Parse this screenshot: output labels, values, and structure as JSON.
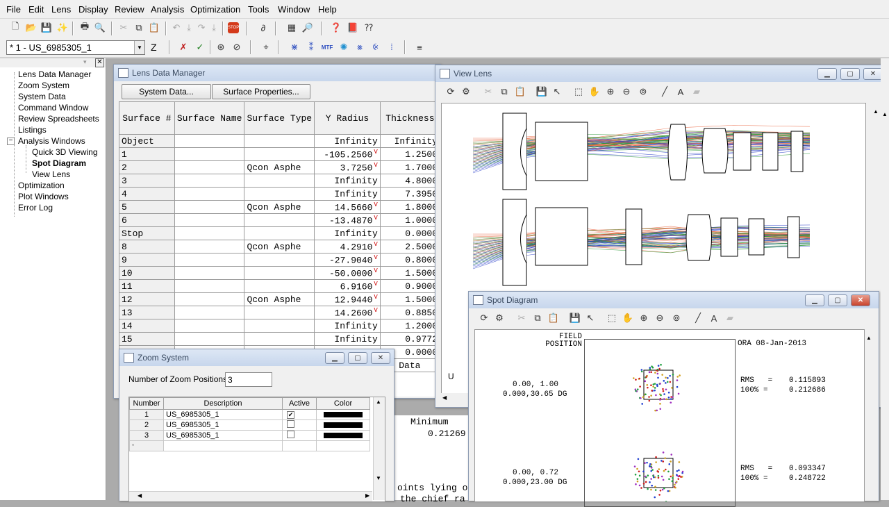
{
  "menu": [
    "File",
    "Edit",
    "Lens",
    "Display",
    "Review",
    "Analysis",
    "Optimization",
    "Tools",
    "Window",
    "Help"
  ],
  "toolbar": {
    "lens_select": "* 1 - US_6985305_1",
    "z_label": "Z"
  },
  "tree": {
    "items": [
      "Lens Data Manager",
      "Zoom System",
      "System Data",
      "Command Window",
      "Review Spreadsheets",
      "Listings",
      "Analysis Windows",
      "Quick 3D Viewing",
      "Spot Diagram",
      "View Lens",
      "Optimization",
      "Plot Windows",
      "Error Log"
    ],
    "expander": "−"
  },
  "ldm": {
    "title": "Lens Data Manager",
    "btn_system": "System Data...",
    "btn_surface": "Surface Properties...",
    "headers": [
      "Surface #",
      "Surface Name",
      "Surface Type",
      "Y Radius",
      "Thickness"
    ],
    "vflag": "V",
    "rows": [
      {
        "s": "Object",
        "n": "",
        "t": "",
        "r": "Infinity",
        "th": "Infinity",
        "v": false
      },
      {
        "s": "1",
        "n": "",
        "t": "",
        "r": "-105.2560",
        "th": "1.2500",
        "v": true
      },
      {
        "s": "2",
        "n": "",
        "t": "Qcon Asphe",
        "r": "3.7250",
        "th": "1.7000",
        "v": true
      },
      {
        "s": "3",
        "n": "",
        "t": "",
        "r": "Infinity",
        "th": "4.8000",
        "v": false
      },
      {
        "s": "4",
        "n": "",
        "t": "",
        "r": "Infinity",
        "th": "7.3950",
        "v": false
      },
      {
        "s": "5",
        "n": "",
        "t": "Qcon Asphe",
        "r": "14.5660",
        "th": "1.8000",
        "v": true
      },
      {
        "s": "6",
        "n": "",
        "t": "",
        "r": "-13.4870",
        "th": "1.0000",
        "v": true
      },
      {
        "s": "Stop",
        "n": "",
        "t": "",
        "r": "Infinity",
        "th": "0.0000",
        "v": false
      },
      {
        "s": "8",
        "n": "",
        "t": "Qcon Asphe",
        "r": "4.2910",
        "th": "2.5000",
        "v": true
      },
      {
        "s": "9",
        "n": "",
        "t": "",
        "r": "-27.9040",
        "th": "0.8000",
        "v": true
      },
      {
        "s": "10",
        "n": "",
        "t": "",
        "r": "-50.0000",
        "th": "1.5000",
        "v": true
      },
      {
        "s": "11",
        "n": "",
        "t": "",
        "r": "6.9160",
        "th": "0.9000",
        "v": true
      },
      {
        "s": "12",
        "n": "",
        "t": "Qcon Asphe",
        "r": "12.9440",
        "th": "1.5000",
        "v": true
      },
      {
        "s": "13",
        "n": "",
        "t": "",
        "r": "14.2600",
        "th": "0.8850",
        "v": true
      },
      {
        "s": "14",
        "n": "",
        "t": "",
        "r": "Infinity",
        "th": "1.2000",
        "v": false
      },
      {
        "s": "15",
        "n": "",
        "t": "",
        "r": "Infinity",
        "th": "0.9772",
        "v": false
      }
    ],
    "partial_thick": "0.0000",
    "partial_end": "of Data"
  },
  "zoom": {
    "title": "Zoom System",
    "positions_label": "Number of Zoom Positions:",
    "positions_value": "3",
    "headers": [
      "Number",
      "Description",
      "Active",
      "Color"
    ],
    "rows": [
      {
        "num": "1",
        "desc": "US_6985305_1",
        "active": "✔"
      },
      {
        "num": "2",
        "desc": "US_6985305_1",
        "active": ""
      },
      {
        "num": "3",
        "desc": "US_6985305_1",
        "active": ""
      }
    ],
    "new_row_marker": "*"
  },
  "behind_text": {
    "line1": "Minimum",
    "line2": "0.21269",
    "line3": "oints lying o",
    "line4": "the chief ra"
  },
  "viewlens": {
    "title": "View Lens",
    "corner_text": "U"
  },
  "spot": {
    "title": "Spot Diagram",
    "field_label": "FIELD\nPOSITION",
    "date": "ORA 08-Jan-2013",
    "fields": [
      {
        "pos1": "0.00, 1.00",
        "pos2": "0.000,30.65 DG",
        "rms_label": "RMS   =",
        "rms": "0.115893",
        "pct_label": "100% =",
        "pct": "0.212686"
      },
      {
        "pos1": "0.00, 0.72",
        "pos2": "0.000,23.00 DG",
        "rms_label": "RMS   =",
        "rms": "0.093347",
        "pct_label": "100% =",
        "pct": "0.248722"
      }
    ]
  },
  "colors": {
    "accent": "#c9432c",
    "title_bar": "#c7d6ec",
    "ray_red": "#e8603a",
    "ray_blue": "#2a3ec8",
    "ray_green": "#2f9a3a"
  }
}
